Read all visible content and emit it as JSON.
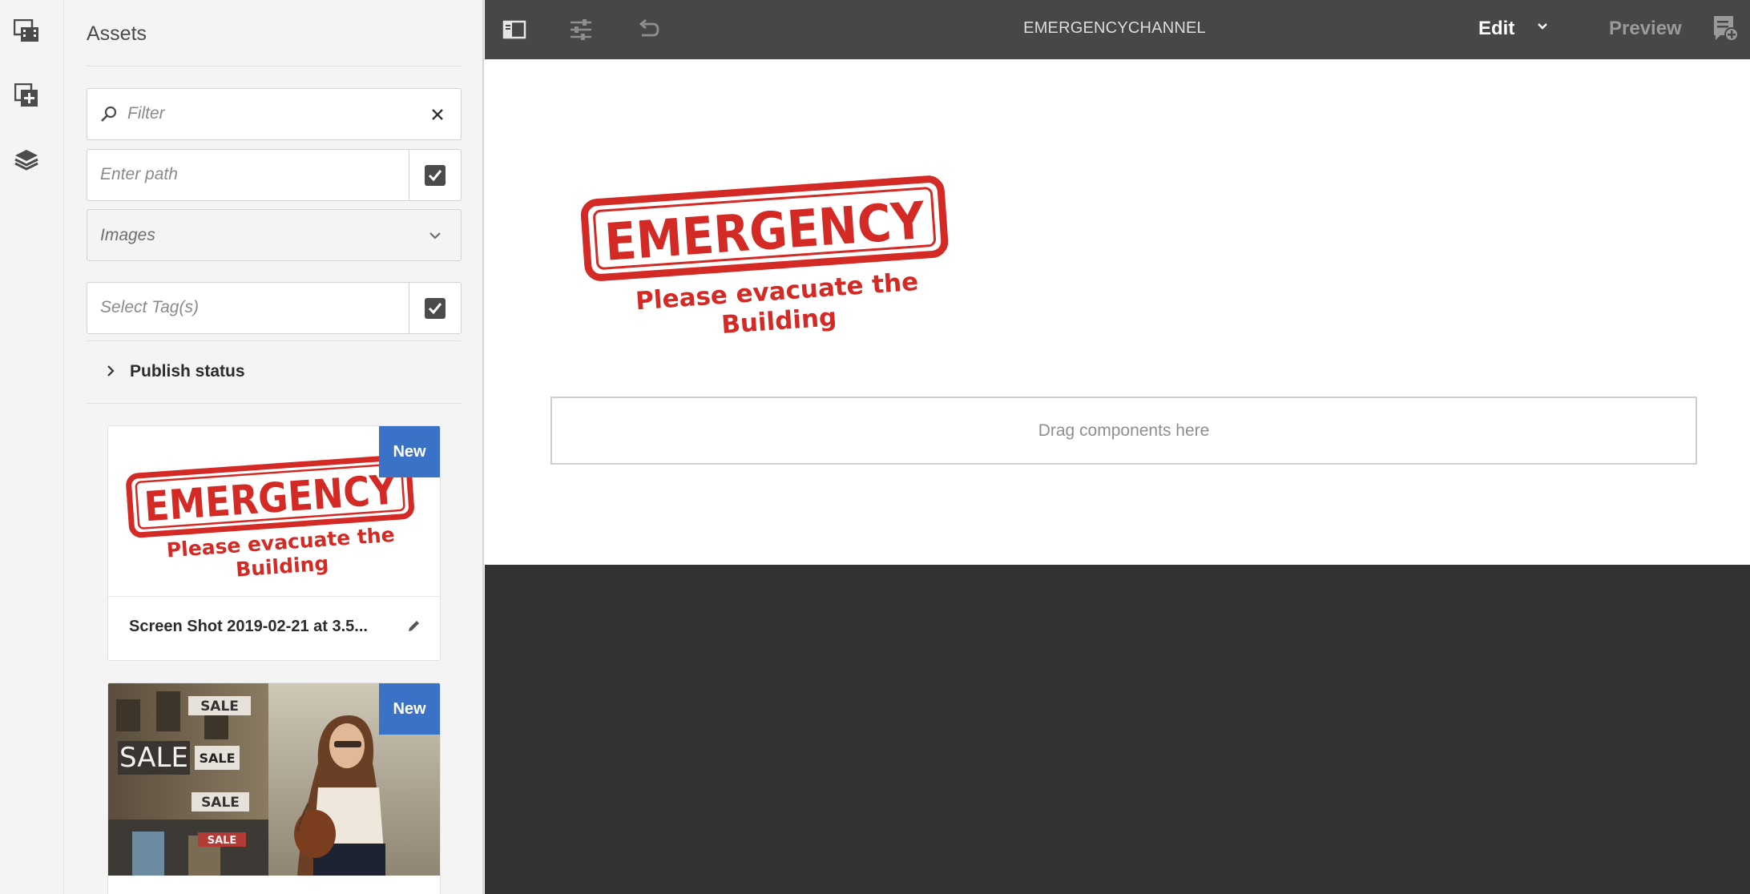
{
  "rail": {
    "items": [
      {
        "name": "assets-browser-icon"
      },
      {
        "name": "components-icon"
      },
      {
        "name": "content-tree-icon"
      }
    ]
  },
  "assets_panel": {
    "title": "Assets",
    "filter_placeholder": "Filter",
    "path_placeholder": "Enter path",
    "type_value": "Images",
    "tags_placeholder": "Select Tag(s)",
    "publish_status_label": "Publish status",
    "cards": [
      {
        "badge": "New",
        "name": "Screen Shot 2019-02-21 at 3.5...",
        "stamp_word": "EMERGENCY",
        "stamp_line1": "Please evacuate the",
        "stamp_line2": "Building"
      },
      {
        "badge": "New",
        "sale_words": [
          "SALE",
          "SALE",
          "SALE",
          "SALE",
          "SALE"
        ]
      }
    ]
  },
  "toolbar": {
    "title": "EMERGENCYCHANNEL",
    "edit_label": "Edit",
    "preview_label": "Preview"
  },
  "canvas": {
    "stamp_word": "EMERGENCY",
    "stamp_line1": "Please evacuate the",
    "stamp_line2": "Building",
    "dropzone_label": "Drag components here"
  },
  "colors": {
    "accent_blue": "#3a72c7",
    "stamp_red": "#d42a25",
    "toolbar_bg": "#474747",
    "dark_area": "#323232"
  }
}
